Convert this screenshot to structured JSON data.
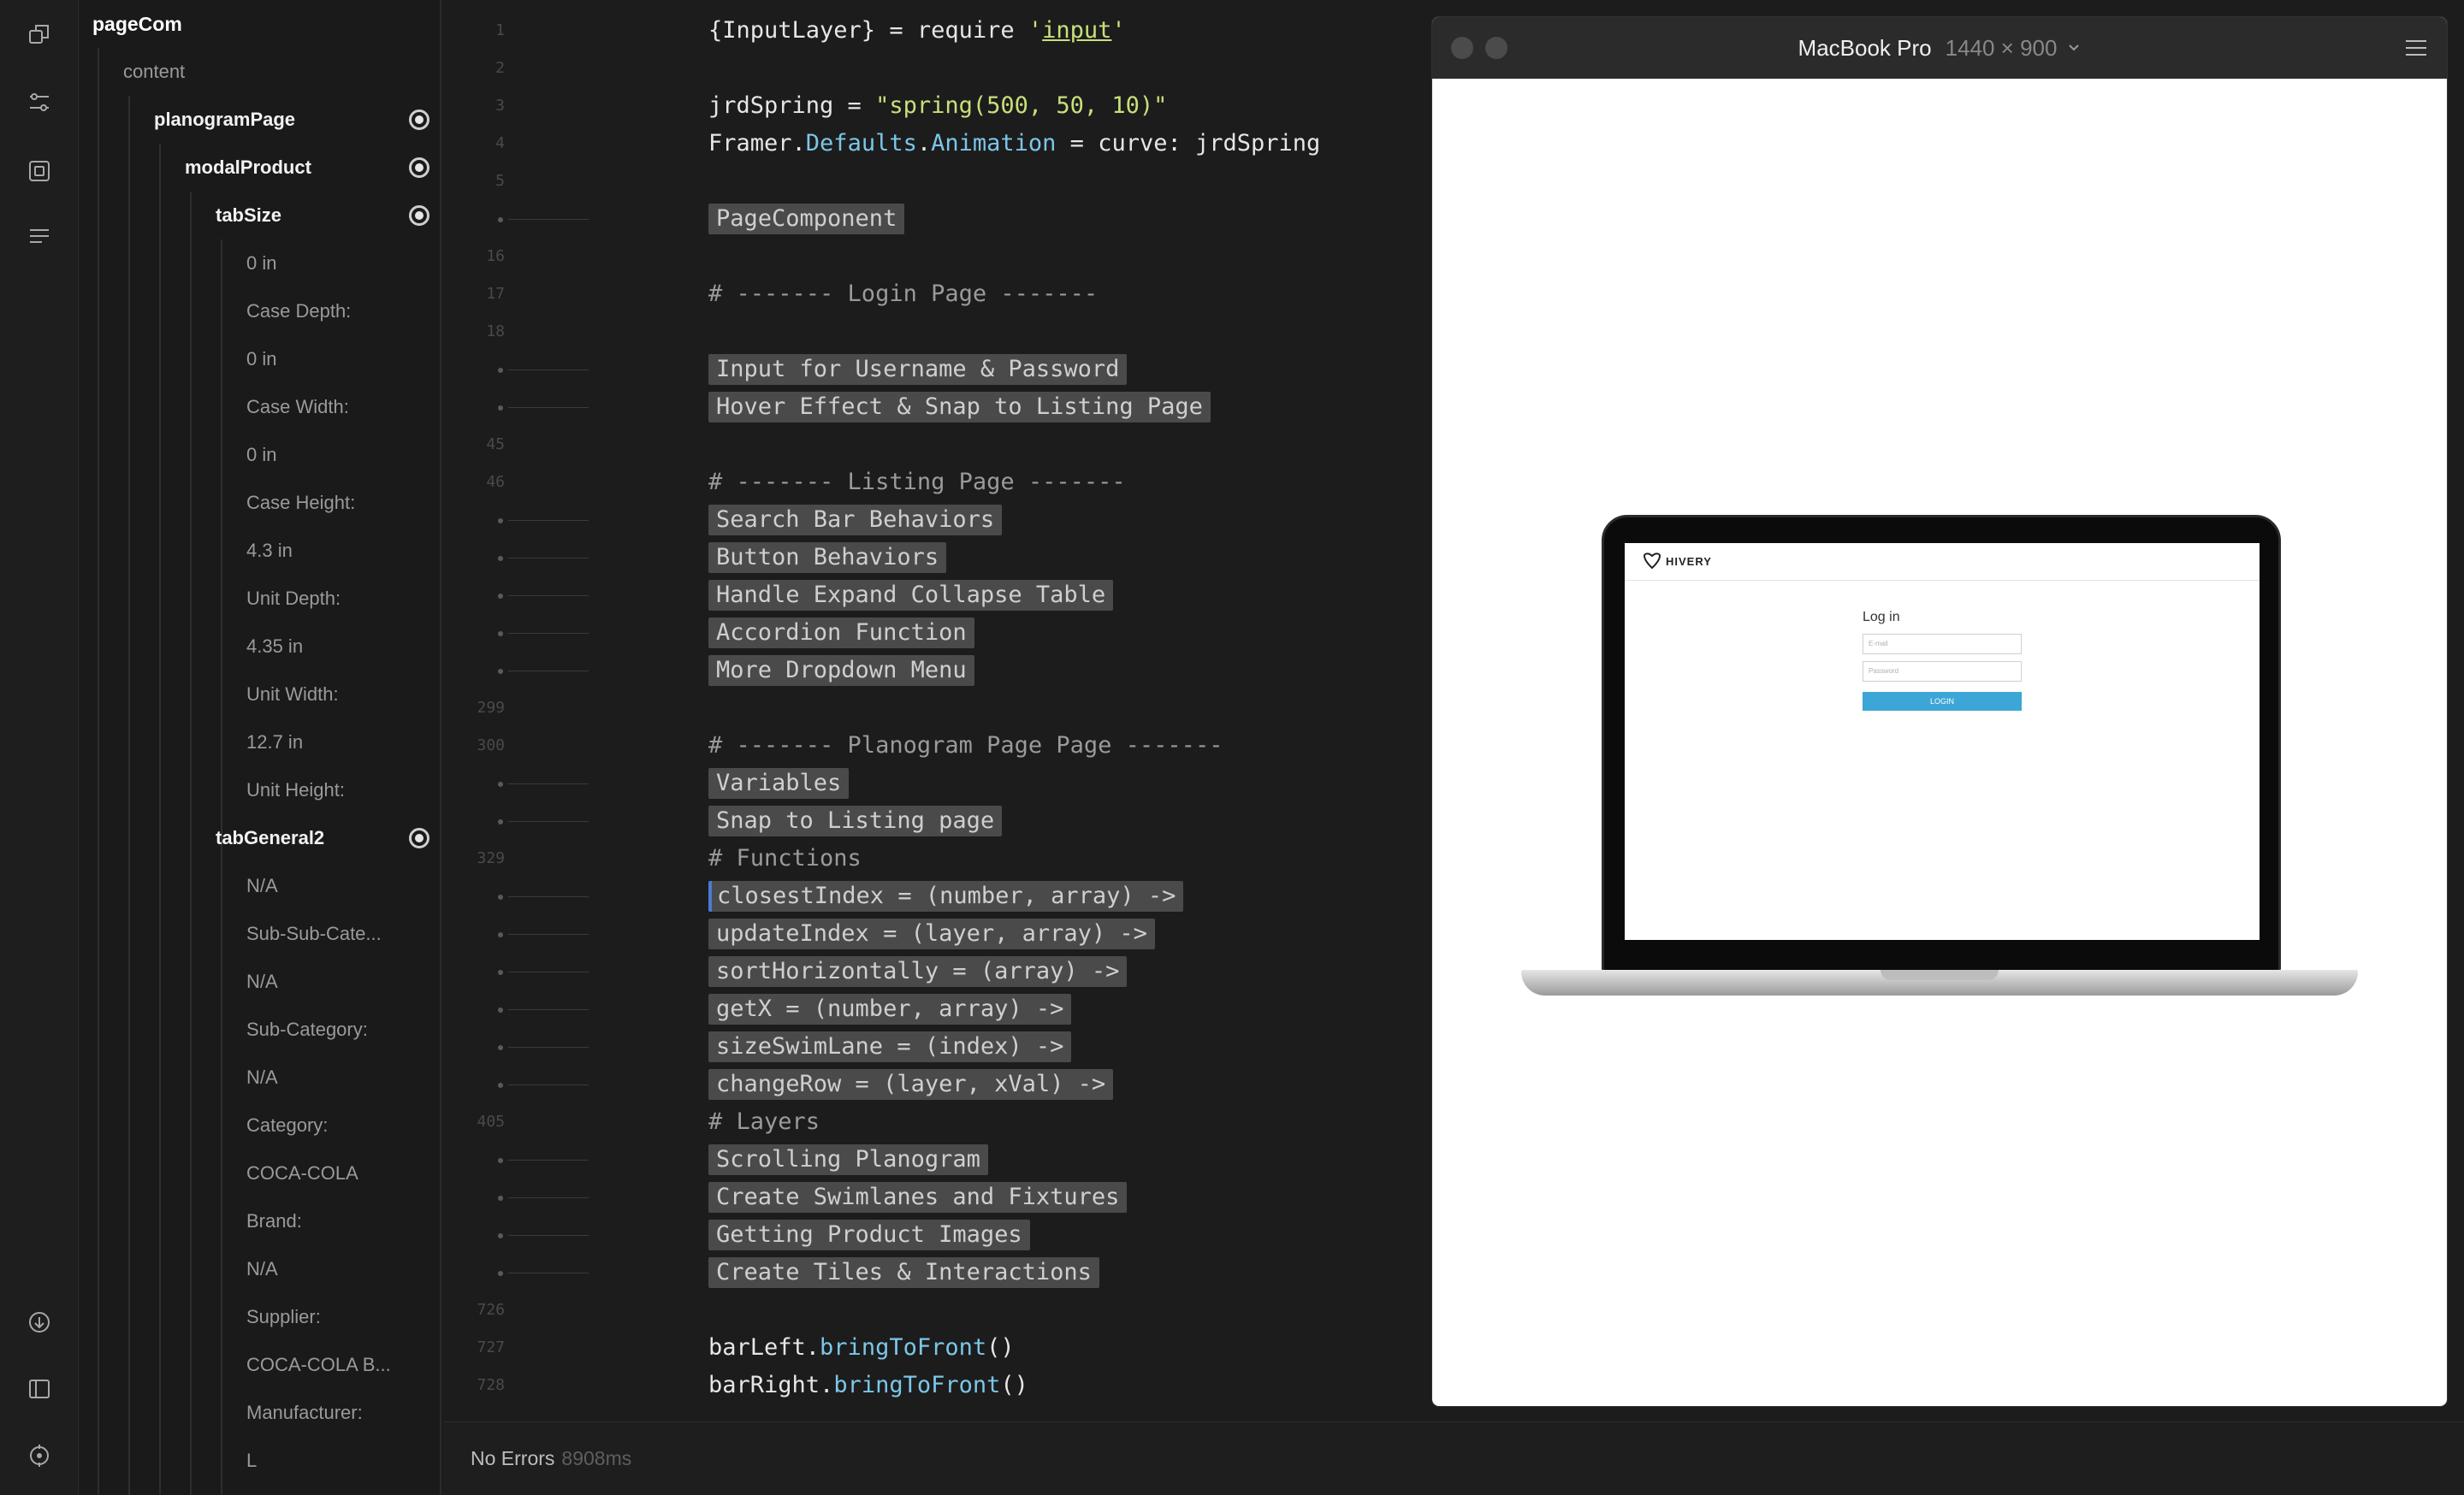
{
  "sidebar_icons": [
    "layers-icon",
    "sliders-icon",
    "component-icon",
    "text-lines-icon",
    "download-icon",
    "panel-icon",
    "target-icon"
  ],
  "layers": [
    {
      "label": "pageCom",
      "bold": true,
      "level": 0,
      "radio": false
    },
    {
      "label": "content",
      "bold": false,
      "level": 1,
      "radio": false
    },
    {
      "label": "planogramPage",
      "bold": true,
      "level": 2,
      "radio": true
    },
    {
      "label": "modalProduct",
      "bold": true,
      "level": 3,
      "radio": true
    },
    {
      "label": "tabSize",
      "bold": true,
      "level": 4,
      "radio": true
    },
    {
      "label": "0 in",
      "bold": false,
      "level": 5,
      "radio": false
    },
    {
      "label": "Case Depth:",
      "bold": false,
      "level": 5,
      "radio": false
    },
    {
      "label": "0 in",
      "bold": false,
      "level": 5,
      "radio": false
    },
    {
      "label": "Case Width:",
      "bold": false,
      "level": 5,
      "radio": false
    },
    {
      "label": "0 in",
      "bold": false,
      "level": 5,
      "radio": false
    },
    {
      "label": "Case Height:",
      "bold": false,
      "level": 5,
      "radio": false
    },
    {
      "label": "4.3 in",
      "bold": false,
      "level": 5,
      "radio": false
    },
    {
      "label": "Unit Depth:",
      "bold": false,
      "level": 5,
      "radio": false
    },
    {
      "label": "4.35 in",
      "bold": false,
      "level": 5,
      "radio": false
    },
    {
      "label": "Unit Width:",
      "bold": false,
      "level": 5,
      "radio": false
    },
    {
      "label": "12.7 in",
      "bold": false,
      "level": 5,
      "radio": false
    },
    {
      "label": "Unit Height:",
      "bold": false,
      "level": 5,
      "radio": false
    },
    {
      "label": "tabGeneral2",
      "bold": true,
      "level": 4,
      "radio": true
    },
    {
      "label": "N/A",
      "bold": false,
      "level": 5,
      "radio": false
    },
    {
      "label": "Sub-Sub-Cate...",
      "bold": false,
      "level": 5,
      "radio": false
    },
    {
      "label": "N/A",
      "bold": false,
      "level": 5,
      "radio": false
    },
    {
      "label": "Sub-Category:",
      "bold": false,
      "level": 5,
      "radio": false
    },
    {
      "label": "N/A",
      "bold": false,
      "level": 5,
      "radio": false
    },
    {
      "label": "Category:",
      "bold": false,
      "level": 5,
      "radio": false
    },
    {
      "label": "COCA-COLA",
      "bold": false,
      "level": 5,
      "radio": false
    },
    {
      "label": "Brand:",
      "bold": false,
      "level": 5,
      "radio": false
    },
    {
      "label": "N/A",
      "bold": false,
      "level": 5,
      "radio": false
    },
    {
      "label": "Supplier:",
      "bold": false,
      "level": 5,
      "radio": false
    },
    {
      "label": "COCA-COLA B...",
      "bold": false,
      "level": 5,
      "radio": false
    },
    {
      "label": "Manufacturer:",
      "bold": false,
      "level": 5,
      "radio": false
    },
    {
      "label": "L",
      "bold": false,
      "level": 5,
      "radio": false
    }
  ],
  "code_lines": [
    {
      "ln": "1",
      "kind": "code",
      "segments": [
        {
          "t": "{InputLayer} = require "
        },
        {
          "t": "'",
          "c": "str"
        },
        {
          "t": "input",
          "c": "strul"
        },
        {
          "t": "'",
          "c": "str"
        }
      ]
    },
    {
      "ln": "2",
      "kind": "blank"
    },
    {
      "ln": "3",
      "kind": "code",
      "segments": [
        {
          "t": "jrdSpring = "
        },
        {
          "t": "\"spring(500, 50, 10)\"",
          "c": "str"
        }
      ]
    },
    {
      "ln": "4",
      "kind": "code",
      "segments": [
        {
          "t": "Framer."
        },
        {
          "t": "Defaults",
          "c": "prop"
        },
        {
          "t": "."
        },
        {
          "t": "Animation",
          "c": "prop"
        },
        {
          "t": " = curve: jrdSpring"
        }
      ]
    },
    {
      "ln": "5",
      "kind": "blank"
    },
    {
      "ln": "",
      "kind": "fold",
      "text": "PageComponent"
    },
    {
      "ln": "16",
      "kind": "blank"
    },
    {
      "ln": "17",
      "kind": "comment",
      "text": "# ------- Login Page -------"
    },
    {
      "ln": "18",
      "kind": "blank"
    },
    {
      "ln": "",
      "kind": "fold",
      "text": "Input for Username & Password"
    },
    {
      "ln": "",
      "kind": "fold",
      "text": "Hover Effect & Snap to Listing Page"
    },
    {
      "ln": "45",
      "kind": "blank"
    },
    {
      "ln": "46",
      "kind": "comment",
      "text": "# ------- Listing Page -------"
    },
    {
      "ln": "",
      "kind": "fold",
      "text": "Search Bar Behaviors"
    },
    {
      "ln": "",
      "kind": "fold",
      "text": "Button Behaviors"
    },
    {
      "ln": "",
      "kind": "fold",
      "text": "Handle Expand Collapse Table"
    },
    {
      "ln": "",
      "kind": "fold",
      "text": "Accordion Function"
    },
    {
      "ln": "",
      "kind": "fold",
      "text": "More Dropdown Menu"
    },
    {
      "ln": "299",
      "kind": "blank"
    },
    {
      "ln": "300",
      "kind": "comment",
      "text": "# ------- Planogram Page Page -------"
    },
    {
      "ln": "",
      "kind": "fold",
      "text": "Variables"
    },
    {
      "ln": "",
      "kind": "fold",
      "text": "Snap to Listing page"
    },
    {
      "ln": "329",
      "kind": "comment",
      "text": "# Functions"
    },
    {
      "ln": "",
      "kind": "fold",
      "text": "closestIndex = (number, array) ->",
      "active": true
    },
    {
      "ln": "",
      "kind": "fold",
      "text": "updateIndex = (layer, array) ->"
    },
    {
      "ln": "",
      "kind": "fold",
      "text": "sortHorizontally = (array) ->"
    },
    {
      "ln": "",
      "kind": "fold",
      "text": "getX = (number, array) ->"
    },
    {
      "ln": "",
      "kind": "fold",
      "text": "sizeSwimLane = (index) ->"
    },
    {
      "ln": "",
      "kind": "fold",
      "text": "changeRow = (layer, xVal) ->"
    },
    {
      "ln": "405",
      "kind": "comment",
      "text": "# Layers"
    },
    {
      "ln": "",
      "kind": "fold",
      "text": "Scrolling Planogram"
    },
    {
      "ln": "",
      "kind": "fold",
      "text": "Create Swimlanes and Fixtures"
    },
    {
      "ln": "",
      "kind": "fold",
      "text": "Getting Product Images"
    },
    {
      "ln": "",
      "kind": "fold",
      "text": "Create Tiles & Interactions"
    },
    {
      "ln": "726",
      "kind": "blank"
    },
    {
      "ln": "727",
      "kind": "code",
      "segments": [
        {
          "t": "barLeft."
        },
        {
          "t": "bringToFront",
          "c": "prop"
        },
        {
          "t": "()"
        }
      ]
    },
    {
      "ln": "728",
      "kind": "code",
      "segments": [
        {
          "t": "barRight."
        },
        {
          "t": "bringToFront",
          "c": "prop"
        },
        {
          "t": "()"
        }
      ]
    }
  ],
  "status": {
    "text": "No Errors",
    "time": "8908ms"
  },
  "preview": {
    "device": "MacBook Pro",
    "resolution": "1440 × 900",
    "app": {
      "logo_text": "HIVERY",
      "login_title": "Log in",
      "email_placeholder": "E-mail",
      "password_placeholder": "Password",
      "login_button": "LOGIN"
    }
  },
  "colors": {
    "background": "#1c1c1c",
    "comment": "#9a9a9a",
    "string": "#c7e07a",
    "property": "#7cc6e8",
    "fold_block": "#4a4a4a",
    "login_button": "#3ca6d6"
  }
}
